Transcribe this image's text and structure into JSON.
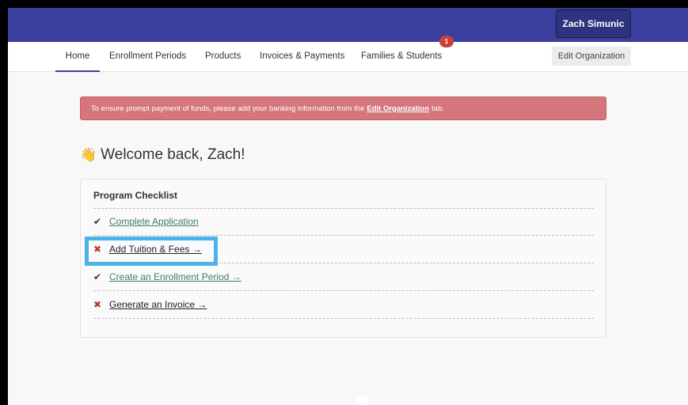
{
  "header": {
    "user_name": "Zach Simunic"
  },
  "nav": {
    "items": [
      {
        "label": "Home"
      },
      {
        "label": "Enrollment Periods"
      },
      {
        "label": "Products"
      },
      {
        "label": "Invoices & Payments"
      },
      {
        "label": "Families & Students"
      }
    ],
    "badge_count": "1",
    "edit_org_label": "Edit Organization"
  },
  "alert": {
    "text_before": "To ensure prompt payment of funds, please add your banking information from the",
    "link_text": "Edit Organization",
    "text_after": "tab."
  },
  "welcome": {
    "emoji": "👋",
    "text": "Welcome back, Zach!"
  },
  "checklist": {
    "title": "Program Checklist",
    "items": [
      {
        "mark": "✔",
        "label": "Complete Application",
        "status": "done"
      },
      {
        "mark": "✖",
        "label": "Add Tuition & Fees →",
        "status": "todo"
      },
      {
        "mark": "✔",
        "label": "Create an Enrollment Period →",
        "status": "done"
      },
      {
        "mark": "✖",
        "label": "Generate an Invoice →",
        "status": "todo"
      }
    ]
  },
  "colors": {
    "brand": "#3b3f9e",
    "alert": "#d4767c",
    "highlight": "#4cb3e8",
    "done_link": "#3f7d6a",
    "todo_mark": "#c0392b"
  }
}
